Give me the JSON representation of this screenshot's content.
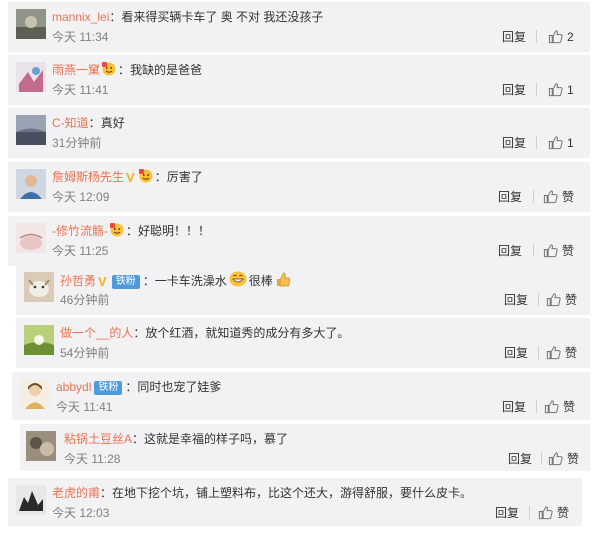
{
  "comments": [
    {
      "user": "mannix_lei",
      "sep": "：",
      "text": "看来得买辆卡车了 奥 不对 我还没孩子",
      "time": "今天 11:34",
      "reply": "回复",
      "like": "2"
    },
    {
      "user": "雨燕一窠",
      "sep": "：",
      "text": "我缺的是爸爸",
      "time": "今天 11:41",
      "reply": "回复",
      "like": "1"
    },
    {
      "user": "C-知道",
      "sep": "：",
      "text": "真好",
      "time": "31分钟前",
      "reply": "回复",
      "like": "1"
    },
    {
      "user": "詹姆斯杨先生",
      "sep": "：",
      "text": "厉害了",
      "time": "今天 12:09",
      "reply": "回复",
      "like": "赞"
    },
    {
      "user": "-修竹流觞-",
      "sep": "：",
      "text": "好聪明！！！",
      "time": "今天 11:25",
      "reply": "回复",
      "like": "赞"
    },
    {
      "user": "孙哲勇",
      "badge": "铁粉",
      "sep": "：",
      "text": "一卡车洗澡水",
      "text2": "很棒",
      "time": "46分钟前",
      "reply": "回复",
      "like": "赞"
    },
    {
      "user": "做一个__的人",
      "sep": "：",
      "text": "放个红酒，就知道秀的成分有多大了。",
      "time": "54分钟前",
      "reply": "回复",
      "like": "赞"
    },
    {
      "user": "abbydl",
      "badge": "铁粉",
      "sep": "：",
      "text": "同时也宠了娃爹",
      "time": "今天 11:41",
      "reply": "回复",
      "like": "赞"
    },
    {
      "user": "粘锅土豆丝A",
      "sep": "：",
      "text": "这就是幸福的样子吗，慕了",
      "time": "今天 11:28",
      "reply": "回复",
      "like": "赞"
    },
    {
      "user": "老虎的甫",
      "sep": "：",
      "text": "在地下挖个坑，铺上塑料布，比这个还大，游得舒服，要什么皮卡。",
      "time": "今天 12:03",
      "reply": "回复",
      "like": "赞"
    }
  ],
  "colors": {
    "username": "#eb7350",
    "card": "#f2f2f5",
    "fan_badge": "#4f9bd9",
    "vip_v": "#f6b11c"
  },
  "icons": {
    "like": "thumbs-up-icon",
    "vip": "vip-v-icon",
    "emoji": "emoji-icon"
  }
}
